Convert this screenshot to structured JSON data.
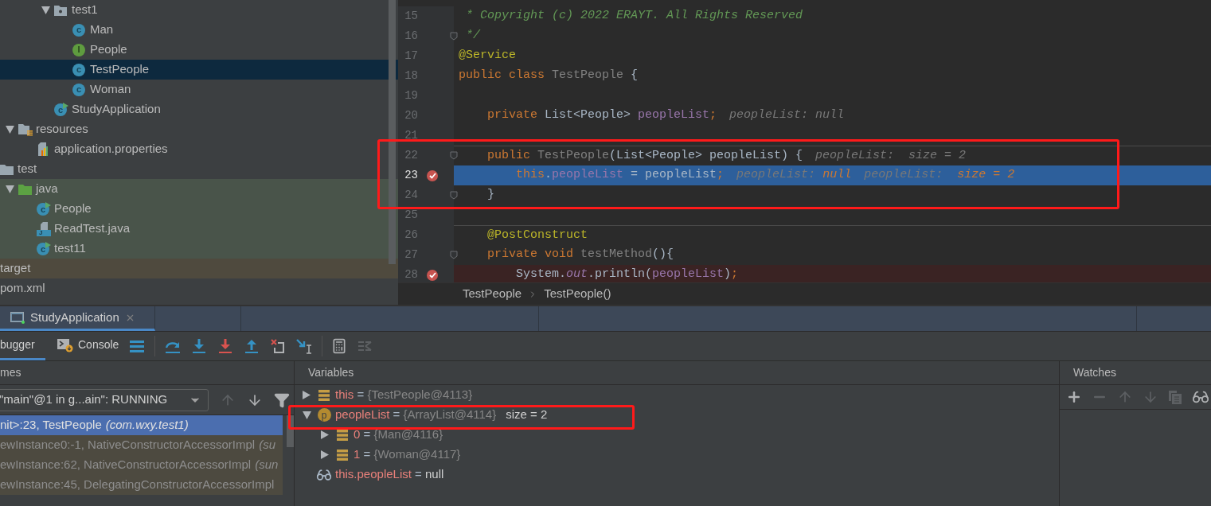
{
  "project_tree": [
    {
      "label": "test1",
      "kind": "package",
      "expanded": true,
      "selected": false,
      "children": [
        {
          "label": "Man",
          "kind": "class",
          "badge": "c",
          "selected": false
        },
        {
          "label": "People",
          "kind": "interface",
          "badge": "I",
          "selected": false
        },
        {
          "label": "TestPeople",
          "kind": "class",
          "badge": "c",
          "selected": true
        },
        {
          "label": "Woman",
          "kind": "class",
          "badge": "c",
          "selected": false
        }
      ]
    },
    {
      "label": "StudyApplication",
      "kind": "runnable",
      "badge": "c",
      "selected": false
    },
    {
      "label": "resources",
      "kind": "resources-folder",
      "expanded": true,
      "selected": false,
      "children": [
        {
          "label": "application.properties",
          "kind": "properties",
          "selected": false
        }
      ]
    },
    {
      "label": "test",
      "kind": "folder",
      "selected": false,
      "children": [
        {
          "label": "java",
          "kind": "test-source-folder",
          "expanded": true,
          "test_scope": true,
          "selected": false,
          "children": [
            {
              "label": "People",
              "kind": "runnable",
              "badge": "c",
              "selected": false
            },
            {
              "label": "ReadTest.java",
              "kind": "java-file",
              "badge": "J",
              "selected": false
            },
            {
              "label": "test11",
              "kind": "runnable",
              "badge": "c",
              "selected": false
            }
          ]
        }
      ]
    },
    {
      "label": "target",
      "excluded": true,
      "selected": false
    },
    {
      "label": "pom.xml",
      "selected": false
    }
  ],
  "editor": {
    "lines": [
      {
        "number": "15",
        "breakpoint": false,
        "selected": false,
        "fold": false,
        "separator": false,
        "tokens": [
          {
            "kind": "comment",
            "text": " * Copyright (c) 2022 ERAYT. All Rights Reserved"
          }
        ]
      },
      {
        "number": "16",
        "breakpoint": false,
        "selected": false,
        "fold": true,
        "separator": false,
        "tokens": [
          {
            "kind": "comment",
            "text": " */"
          }
        ]
      },
      {
        "number": "17",
        "breakpoint": false,
        "selected": false,
        "fold": false,
        "separator": false,
        "tokens": [
          {
            "kind": "annotation",
            "text": "@Service"
          }
        ]
      },
      {
        "number": "18",
        "breakpoint": false,
        "selected": false,
        "fold": false,
        "separator": false,
        "tokens": [
          {
            "kind": "keyword",
            "text": "public class "
          },
          {
            "kind": "unused",
            "text": "TestPeople"
          },
          {
            "kind": "plain",
            "text": " {"
          }
        ]
      },
      {
        "number": "19",
        "breakpoint": false,
        "selected": false,
        "fold": false,
        "separator": false
      },
      {
        "number": "20",
        "breakpoint": false,
        "selected": false,
        "fold": false,
        "separator": false,
        "tokens": [
          {
            "kind": "keyword",
            "text": "    private "
          },
          {
            "kind": "plain",
            "text": "List<People> "
          },
          {
            "kind": "field",
            "text": "peopleList"
          },
          {
            "kind": "keyword",
            "text": ";"
          },
          {
            "kind": "hint",
            "text": "peopleList: null"
          }
        ]
      },
      {
        "number": "21",
        "breakpoint": false,
        "selected": false,
        "fold": false,
        "separator": false
      },
      {
        "number": "22",
        "breakpoint": false,
        "selected": false,
        "fold": true,
        "separator": true,
        "tokens": [
          {
            "kind": "keyword",
            "text": "    public "
          },
          {
            "kind": "unused",
            "text": "TestPeople"
          },
          {
            "kind": "plain",
            "text": "(List<People> peopleList) {"
          },
          {
            "kind": "hint",
            "text": "peopleList:  size = 2"
          }
        ]
      },
      {
        "number": "23",
        "breakpoint": true,
        "selected": true,
        "fold": false,
        "separator": false,
        "tokens": [
          {
            "kind": "keyword",
            "text": "        this"
          },
          {
            "kind": "plain",
            "text": "."
          },
          {
            "kind": "field",
            "text": "peopleList"
          },
          {
            "kind": "plain",
            "text": " = peopleList"
          },
          {
            "kind": "keyword",
            "text": ";"
          },
          {
            "kind": "hint",
            "text": "peopleList: "
          },
          {
            "kind": "hint-value",
            "text": "null"
          },
          {
            "kind": "hint",
            "text": "peopleList: "
          },
          {
            "kind": "hint-value",
            "text": " size = 2"
          }
        ]
      },
      {
        "number": "24",
        "breakpoint": false,
        "selected": false,
        "fold": true,
        "separator": false,
        "tokens": [
          {
            "kind": "plain",
            "text": "    }"
          }
        ]
      },
      {
        "number": "25",
        "breakpoint": false,
        "selected": false,
        "fold": false,
        "separator": false
      },
      {
        "number": "26",
        "breakpoint": false,
        "selected": false,
        "fold": false,
        "separator": true,
        "tokens": [
          {
            "kind": "annotation",
            "text": "    @PostConstruct"
          }
        ]
      },
      {
        "number": "27",
        "breakpoint": false,
        "selected": false,
        "fold": true,
        "separator": false,
        "tokens": [
          {
            "kind": "keyword",
            "text": "    private void "
          },
          {
            "kind": "unused",
            "text": "testMethod"
          },
          {
            "kind": "plain",
            "text": "(){"
          }
        ]
      },
      {
        "number": "28",
        "breakpoint": true,
        "selected": false,
        "fold": false,
        "separator": false,
        "tokens": [
          {
            "kind": "plain",
            "text": "        System."
          },
          {
            "kind": "static",
            "text": "out"
          },
          {
            "kind": "plain",
            "text": ".println("
          },
          {
            "kind": "field",
            "text": "peopleList"
          },
          {
            "kind": "plain",
            "text": ")"
          },
          {
            "kind": "keyword",
            "text": ";"
          }
        ]
      }
    ],
    "breadcrumb": [
      "TestPeople",
      "TestPeople()"
    ]
  },
  "run_tab": {
    "title": "StudyApplication"
  },
  "debug_tabs": [
    {
      "label": "bugger",
      "kind": "debugger",
      "selected": true
    },
    {
      "label": "Console",
      "kind": "console",
      "selected": false
    }
  ],
  "debug_actions": [
    {
      "kind": "layout",
      "disabled": false
    },
    {
      "kind": "step-over",
      "disabled": false
    },
    {
      "kind": "step-into",
      "disabled": false
    },
    {
      "kind": "force-step-into",
      "disabled": false
    },
    {
      "kind": "step-out",
      "disabled": false
    },
    {
      "kind": "drop-frame",
      "disabled": false
    },
    {
      "kind": "run-to-cursor",
      "disabled": false
    },
    {
      "kind": "evaluate",
      "disabled": false
    },
    {
      "kind": "trace",
      "disabled": true
    }
  ],
  "frames": {
    "title": "mes",
    "thread_selector": {
      "value": "\"main\"@1 in g...ain\": RUNNING"
    },
    "nav": [
      {
        "kind": "up",
        "disabled": true
      },
      {
        "kind": "down",
        "disabled": false
      },
      {
        "kind": "filter",
        "disabled": false
      }
    ],
    "items": [
      {
        "text": "nit>:23, TestPeople",
        "package": "(com.wxy.test1)",
        "selected": true,
        "library": false
      },
      {
        "text": "ewInstance0:-1, NativeConstructorAccessorImpl",
        "package": "(su",
        "selected": false,
        "library": true
      },
      {
        "text": "ewInstance:62, NativeConstructorAccessorImpl",
        "package": "(sun",
        "selected": false,
        "library": true
      },
      {
        "text": "ewInstance:45, DelegatingConstructorAccessorImpl",
        "selected": false,
        "library": true
      }
    ]
  },
  "variables": {
    "title": "Variables",
    "items": [
      {
        "name": "this",
        "op": "=",
        "value": "{TestPeople@4113}",
        "kind": "field",
        "expanded": false
      },
      {
        "name": "peopleList",
        "op": "=",
        "value": "{ArrayList@4114}",
        "extra": "size = 2",
        "kind": "param",
        "badge": "p",
        "expanded": true,
        "children": [
          {
            "name": "0",
            "op": "=",
            "value": "{Man@4116}",
            "kind": "field",
            "expanded": false
          },
          {
            "name": "1",
            "op": "=",
            "value": "{Woman@4117}",
            "kind": "field",
            "expanded": false
          }
        ]
      },
      {
        "name": "this.peopleList",
        "op": "=",
        "value": "null",
        "kind": "watch"
      }
    ]
  },
  "watches": {
    "title": "Watches",
    "actions": [
      {
        "kind": "add",
        "disabled": false
      },
      {
        "kind": "remove",
        "disabled": true
      },
      {
        "kind": "up",
        "disabled": true
      },
      {
        "kind": "down",
        "disabled": true
      },
      {
        "kind": "copy",
        "disabled": true
      },
      {
        "kind": "watch",
        "disabled": false
      }
    ]
  }
}
